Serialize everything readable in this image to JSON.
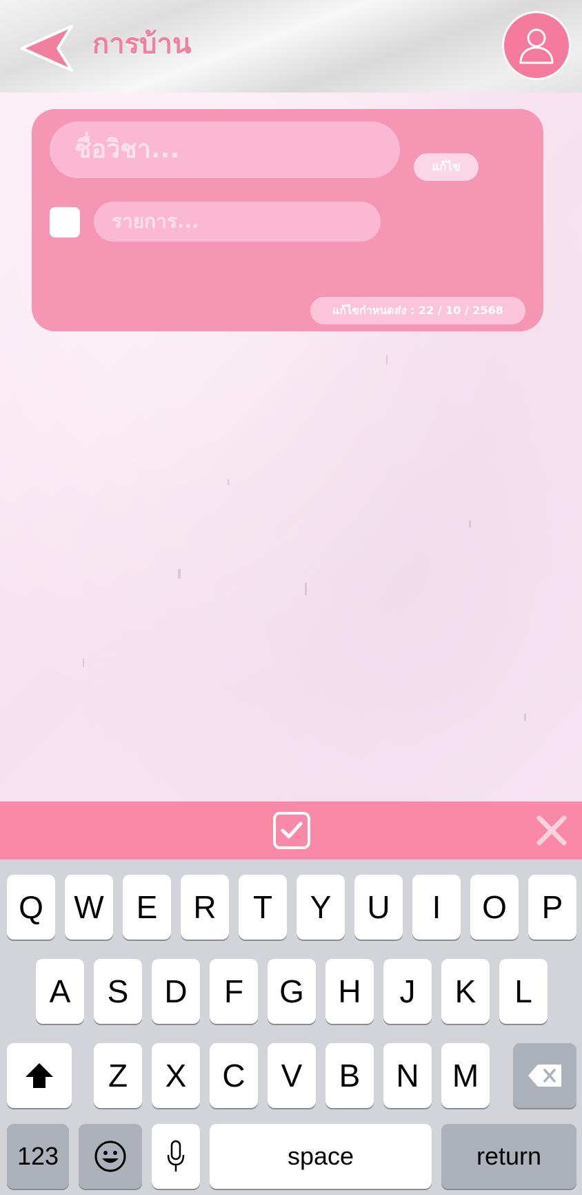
{
  "header": {
    "title": "การบ้าน",
    "back_icon": "back-arrow-icon",
    "avatar_icon": "user-profile-icon",
    "accent": "#f27fa0"
  },
  "card": {
    "subject_placeholder": "ชื่อวิชา...",
    "edit_label": "แก้ไข",
    "item_placeholder": "รายการ...",
    "due_label": "แก้ไขกำหนดส่ง : 22 / 10 / 2568",
    "card_color": "#f597b4"
  },
  "accessory": {
    "confirm_icon": "checkbox-check-icon",
    "close_icon": "close-icon",
    "bar_color": "#f989a7"
  },
  "keyboard": {
    "row1": [
      "Q",
      "W",
      "E",
      "R",
      "T",
      "Y",
      "U",
      "I",
      "O",
      "P"
    ],
    "row2": [
      "A",
      "S",
      "D",
      "F",
      "G",
      "H",
      "J",
      "K",
      "L"
    ],
    "row3": [
      "Z",
      "X",
      "C",
      "V",
      "B",
      "N",
      "M"
    ],
    "shift_icon": "shift-icon",
    "delete_icon": "backspace-icon",
    "numbers_label": "123",
    "emoji_icon": "emoji-icon",
    "mic_icon": "microphone-icon",
    "space_label": "space",
    "return_label": "return"
  }
}
